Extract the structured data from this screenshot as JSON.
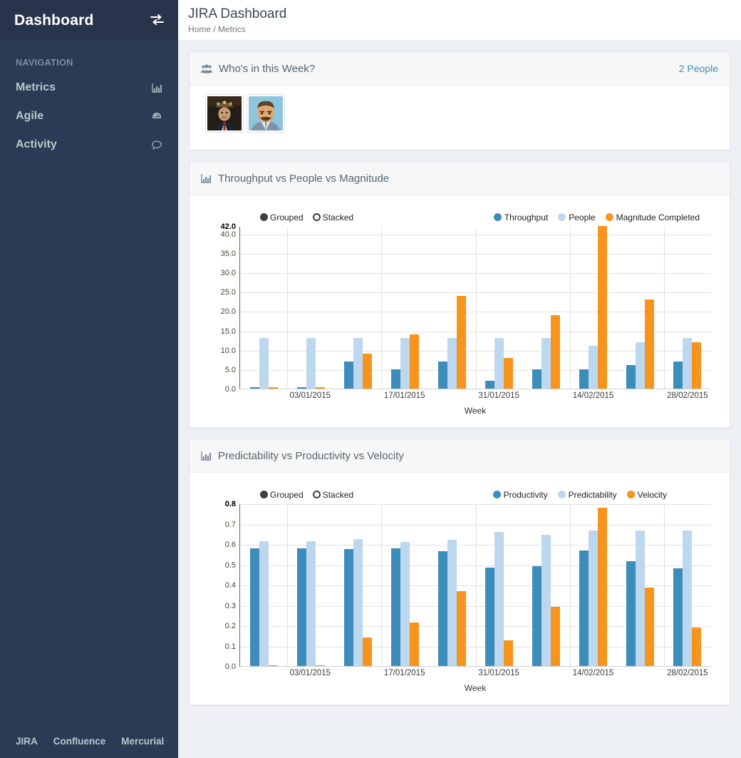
{
  "sidebar": {
    "brand": "Dashboard",
    "toggle_icon": "exchange-icon",
    "nav_header": "NAVIGATION",
    "items": [
      {
        "label": "Metrics",
        "icon": "bar-chart-icon"
      },
      {
        "label": "Agile",
        "icon": "dashboard-gauge-icon"
      },
      {
        "label": "Activity",
        "icon": "comment-icon"
      }
    ],
    "footer_links": [
      "JIRA",
      "Confluence",
      "Mercurial"
    ]
  },
  "header": {
    "title": "JIRA Dashboard",
    "breadcrumb": "Home / Metrics"
  },
  "people_box": {
    "icon": "group-users-icon",
    "title": "Who's in this Week?",
    "count_label": "2 People",
    "avatars": [
      {
        "name": "avatar-person-1"
      },
      {
        "name": "avatar-person-2"
      }
    ]
  },
  "colors": {
    "sidebar_bg": "#2c3b55",
    "sidebar_logo_bg": "#27344c",
    "accent_link": "#3c8dbc",
    "series_dark_blue": "#3c8dbc",
    "series_light_blue": "#bdd7ee",
    "series_orange": "#f7941e"
  },
  "charts": [
    {
      "panel_icon": "bar-chart-icon",
      "panel_title": "Throughput vs People vs Magnitude",
      "mode_options": [
        {
          "label": "Grouped",
          "selected": true
        },
        {
          "label": "Stacked",
          "selected": false
        }
      ]
    },
    {
      "panel_icon": "bar-chart-icon",
      "panel_title": "Predictability vs Productivity vs Velocity",
      "mode_options": [
        {
          "label": "Grouped",
          "selected": true
        },
        {
          "label": "Stacked",
          "selected": false
        }
      ]
    }
  ],
  "chart_data": [
    {
      "type": "bar",
      "title": "Throughput vs People vs Magnitude",
      "xlabel": "Week",
      "ylabel": "",
      "ylim": [
        0,
        42
      ],
      "grid": true,
      "legend_position": "top-right",
      "yticks": [
        "0.0",
        "5.0",
        "10.0",
        "15.0",
        "20.0",
        "25.0",
        "30.0",
        "35.0",
        "40.0"
      ],
      "peak_tick": "42.0",
      "categories": [
        "",
        "03/01/2015",
        "",
        "",
        "17/01/2015",
        "",
        "",
        "31/01/2015",
        "",
        "",
        "14/02/2015",
        "",
        "",
        "28/02/2015",
        ""
      ],
      "tick_labels": [
        "03/01/2015",
        "17/01/2015",
        "31/01/2015",
        "14/02/2015",
        "28/02/2015"
      ],
      "series": [
        {
          "name": "Throughput",
          "color": "#3c8dbc",
          "values": [
            0.3,
            0.3,
            7,
            5,
            7,
            2,
            5,
            5,
            6,
            7
          ]
        },
        {
          "name": "People",
          "color": "#bdd7ee",
          "values": [
            13,
            13,
            13,
            13,
            13,
            13,
            13,
            11,
            12,
            13
          ]
        },
        {
          "name": "Magnitude Completed",
          "color": "#f7941e",
          "values": [
            0.3,
            0.3,
            9,
            14,
            24,
            8,
            19,
            42,
            23,
            12
          ]
        }
      ]
    },
    {
      "type": "bar",
      "title": "Predictability vs Productivity vs Velocity",
      "xlabel": "Week",
      "ylabel": "",
      "ylim": [
        0,
        0.8
      ],
      "grid": true,
      "legend_position": "top-right",
      "yticks": [
        "0.0",
        "0.1",
        "0.2",
        "0.3",
        "0.4",
        "0.5",
        "0.6",
        "0.7",
        "0.8"
      ],
      "peak_tick": "0.8",
      "tick_labels": [
        "03/01/2015",
        "17/01/2015",
        "31/01/2015",
        "14/02/2015",
        "28/02/2015"
      ],
      "series": [
        {
          "name": "Productivity",
          "color": "#3c8dbc",
          "values": [
            0.58,
            0.58,
            0.575,
            0.58,
            0.565,
            0.485,
            0.49,
            0.57,
            0.515,
            0.48
          ]
        },
        {
          "name": "Predictability",
          "color": "#bdd7ee",
          "values": [
            0.615,
            0.615,
            0.625,
            0.61,
            0.62,
            0.66,
            0.645,
            0.665,
            0.665,
            0.665
          ]
        },
        {
          "name": "Velocity",
          "color": "#f7941e",
          "values": [
            0.005,
            0.005,
            0.14,
            0.215,
            0.37,
            0.125,
            0.29,
            0.78,
            0.385,
            0.19
          ]
        }
      ]
    }
  ]
}
